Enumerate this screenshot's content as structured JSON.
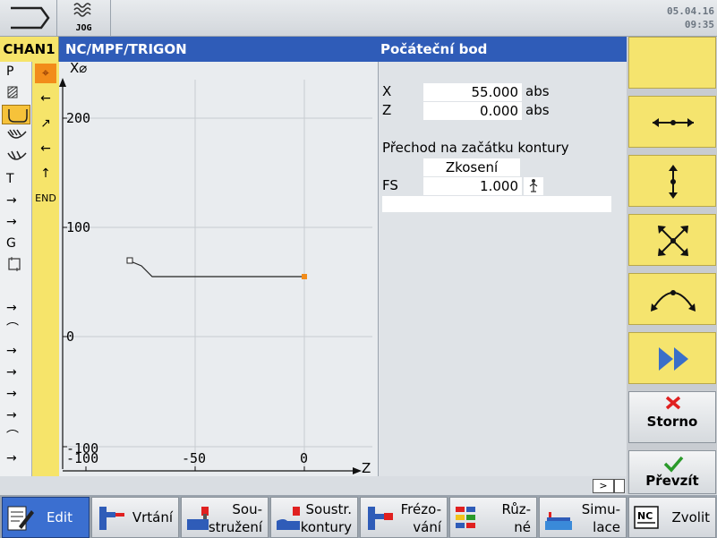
{
  "topbar": {
    "mode_label": "JOG",
    "date": "05.04.16",
    "time": "09:35"
  },
  "header": {
    "channel": "CHAN1",
    "program_path": "NC/MPF/TRIGON",
    "panel_title": "Počáteční bod"
  },
  "left_column": {
    "items": [
      "P",
      "T",
      "G"
    ]
  },
  "contour_column": {
    "end_label": "END"
  },
  "graph": {
    "y_axis_label": "X⌀",
    "x_axis_label": "Z",
    "y_ticks": [
      "200",
      "100",
      "0",
      "-100"
    ],
    "x_ticks": [
      "-100",
      "-50",
      "0"
    ]
  },
  "params": {
    "x_label": "X",
    "x_value": "55.000",
    "x_unit": "abs",
    "z_label": "Z",
    "z_value": "0.000",
    "z_unit": "abs",
    "transition_heading": "Přechod na začátku kontury",
    "transition_type": "Zkosení",
    "fs_label": "FS",
    "fs_value": "1.000"
  },
  "right_softkeys": {
    "cancel_label": "Storno",
    "accept_label": "Převzít",
    "cancel_color": "#e02020",
    "accept_color": "#2a9a2a"
  },
  "scroll": {
    "label": ">"
  },
  "bottom_softkeys": {
    "edit": "Edit",
    "drilling": "Vrtání",
    "turning_l1": "Sou-",
    "turning_l2": "stružení",
    "contour_turning_l1": "Soustr.",
    "contour_turning_l2": "kontury",
    "milling_l1": "Frézo-",
    "milling_l2": "vání",
    "misc_l1": "Růz-",
    "misc_l2": "né",
    "simulation_l1": "Simu-",
    "simulation_l2": "lace",
    "select": "Zvolit",
    "select_icon_text": "NC"
  },
  "colors": {
    "accent_blue": "#2f5cb8",
    "softkey_yellow": "#f5e46e",
    "selected_orange": "#f28c1a"
  }
}
